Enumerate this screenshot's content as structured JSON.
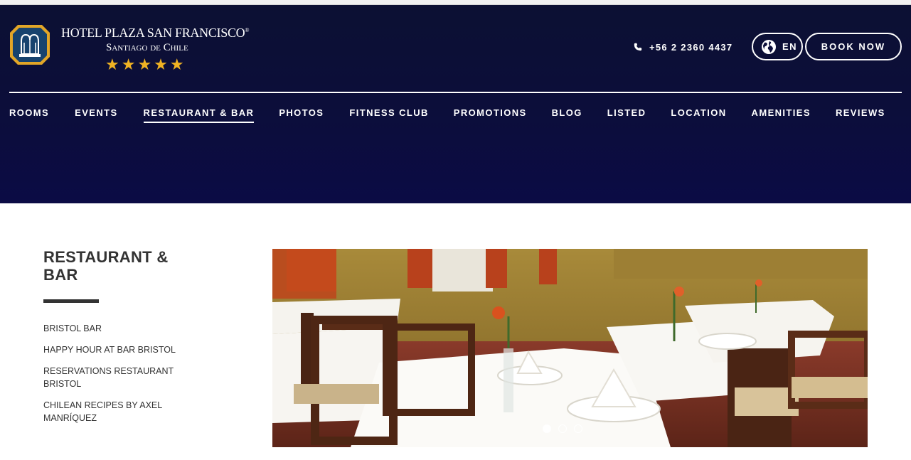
{
  "brand": {
    "name": "HOTEL PLAZA SAN FRANCISCO",
    "registered": "®",
    "subtitle": "Santiago de Chile",
    "stars": "★★★★★"
  },
  "header": {
    "phone": "+56 2 2360 4437",
    "language": "EN",
    "book_label": "BOOK NOW"
  },
  "nav": {
    "items": [
      {
        "label": "ROOMS"
      },
      {
        "label": "EVENTS"
      },
      {
        "label": "RESTAURANT & BAR"
      },
      {
        "label": "PHOTOS"
      },
      {
        "label": "FITNESS CLUB"
      },
      {
        "label": "PROMOTIONS"
      },
      {
        "label": "BLOG"
      },
      {
        "label": "LISTED"
      },
      {
        "label": "LOCATION"
      },
      {
        "label": "AMENITIES"
      },
      {
        "label": "REVIEWS"
      }
    ],
    "active": "RESTAURANT & BAR"
  },
  "sidebar": {
    "title": "RESTAURANT & BAR",
    "links": [
      {
        "label": "BRISTOL BAR"
      },
      {
        "label": "HAPPY HOUR AT BAR BRISTOL"
      },
      {
        "label": "RESERVATIONS RESTAURANT BRISTOL"
      },
      {
        "label": "CHILEAN RECIPES BY AXEL MANRÍQUEZ"
      }
    ]
  },
  "colors": {
    "header_bg": "#0c0e3a",
    "star_gold": "#f0b323",
    "text_dark": "#333333"
  },
  "icons": {
    "phone": "phone-icon",
    "language": "globe-icon",
    "logo": "crest-icon"
  }
}
